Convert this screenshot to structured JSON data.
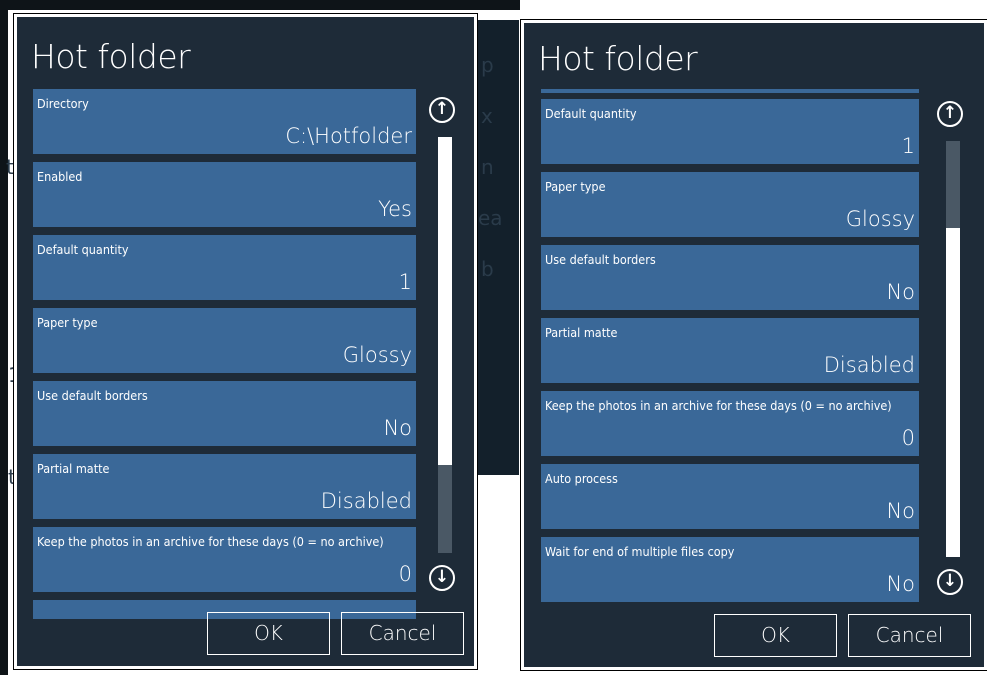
{
  "dialog_left": {
    "title": "Hot folder",
    "rows": [
      {
        "label": "Directory",
        "value": "C:\\Hotfolder"
      },
      {
        "label": "Enabled",
        "value": "Yes"
      },
      {
        "label": "Default quantity",
        "value": "1"
      },
      {
        "label": "Paper type",
        "value": "Glossy"
      },
      {
        "label": "Use default borders",
        "value": "No"
      },
      {
        "label": "Partial matte",
        "value": "Disabled"
      },
      {
        "label": "Keep the photos in an archive for these days (0 = no archive)",
        "value": "0"
      }
    ],
    "scroll_position": 0.0,
    "ok_label": "OK",
    "cancel_label": "Cancel"
  },
  "dialog_right": {
    "title": "Hot folder",
    "rows": [
      {
        "label": "Default quantity",
        "value": "1"
      },
      {
        "label": "Paper type",
        "value": "Glossy"
      },
      {
        "label": "Use default borders",
        "value": "No"
      },
      {
        "label": "Partial matte",
        "value": "Disabled"
      },
      {
        "label": "Keep the photos in an archive for these days (0 = no archive)",
        "value": "0"
      },
      {
        "label": "Auto process",
        "value": "No"
      },
      {
        "label": "Wait for end of multiple files copy",
        "value": "No"
      }
    ],
    "scroll_position": 1.0,
    "ok_label": "OK",
    "cancel_label": "Cancel"
  },
  "background_fragments": [
    "p",
    "x",
    "n",
    "ea",
    "b",
    "ti",
    "1",
    "t"
  ],
  "icons": {
    "scroll_up": "arrow-up-circle-icon",
    "scroll_down": "arrow-down-circle-icon"
  },
  "colors": {
    "dialog_bg": "#1e2b38",
    "row_bg": "#3a6898",
    "text": "#ffffff",
    "border": "#ffffff"
  }
}
